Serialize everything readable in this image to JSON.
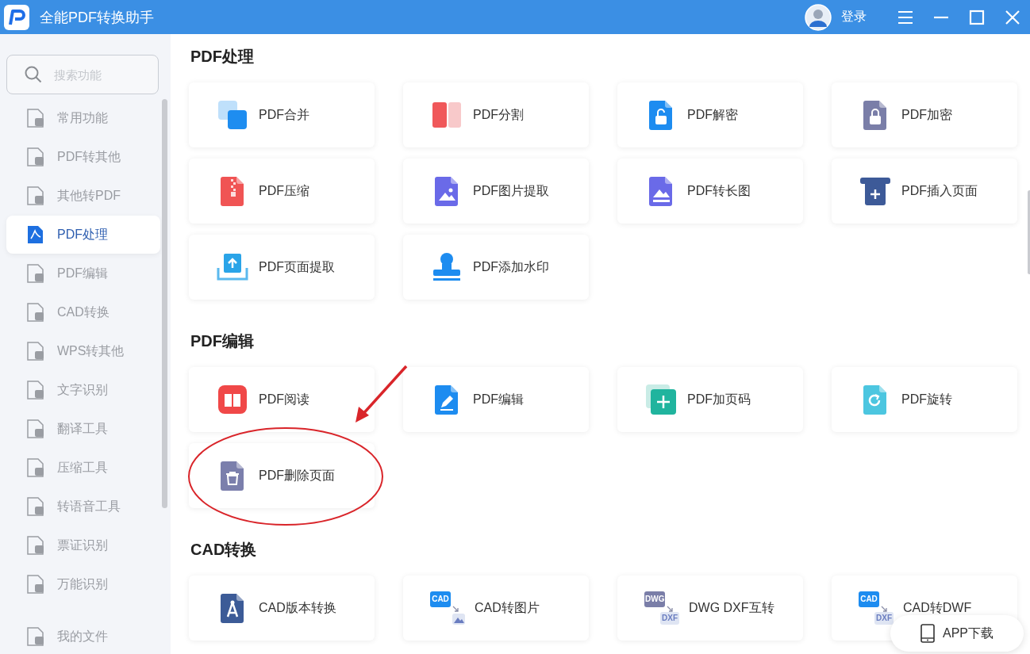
{
  "window": {
    "title": "全能PDF转换助手",
    "login": "登录"
  },
  "sidebar": {
    "search": {
      "placeholder": "搜索功能"
    },
    "items": [
      {
        "label": "常用功能",
        "selected": false
      },
      {
        "label": "PDF转其他",
        "selected": false
      },
      {
        "label": "其他转PDF",
        "selected": false
      },
      {
        "label": "PDF处理",
        "selected": true
      },
      {
        "label": "PDF编辑",
        "selected": false
      },
      {
        "label": "CAD转换",
        "selected": false
      },
      {
        "label": "WPS转其他",
        "selected": false
      },
      {
        "label": "文字识别",
        "selected": false
      },
      {
        "label": "翻译工具",
        "selected": false
      },
      {
        "label": "压缩工具",
        "selected": false
      },
      {
        "label": "转语音工具",
        "selected": false
      },
      {
        "label": "票证识别",
        "selected": false
      },
      {
        "label": "万能识别",
        "selected": false
      }
    ],
    "footer": {
      "label": "我的文件"
    }
  },
  "sections": [
    {
      "heading": "PDF处理",
      "cards": [
        {
          "label": "PDF合并",
          "kind": "merge"
        },
        {
          "label": "PDF分割",
          "kind": "split"
        },
        {
          "label": "PDF解密",
          "kind": "unlock"
        },
        {
          "label": "PDF加密",
          "kind": "lock"
        },
        {
          "label": "PDF压缩",
          "kind": "zip"
        },
        {
          "label": "PDF图片提取",
          "kind": "image"
        },
        {
          "label": "PDF转长图",
          "kind": "long-image"
        },
        {
          "label": "PDF插入页面",
          "kind": "insert"
        },
        {
          "label": "PDF页面提取",
          "kind": "extract"
        },
        {
          "label": "PDF添加水印",
          "kind": "watermark"
        }
      ]
    },
    {
      "heading": "PDF编辑",
      "cards": [
        {
          "label": "PDF阅读",
          "kind": "read"
        },
        {
          "label": "PDF编辑",
          "kind": "edit"
        },
        {
          "label": "PDF加页码",
          "kind": "page-number"
        },
        {
          "label": "PDF旋转",
          "kind": "rotate"
        },
        {
          "label": "PDF删除页面",
          "kind": "delete"
        }
      ]
    },
    {
      "heading": "CAD转换",
      "cards": [
        {
          "label": "CAD版本转换",
          "kind": "cad-version"
        },
        {
          "label": "CAD转图片",
          "kind": "format",
          "badges": [
            "CAD"
          ]
        },
        {
          "label": "DWG DXF互转",
          "kind": "format",
          "badges": [
            "DWG",
            "DXF"
          ]
        },
        {
          "label": "CAD转DWF",
          "kind": "format",
          "badges": [
            "CAD",
            "DXF"
          ]
        }
      ]
    }
  ],
  "app_download": {
    "label": "APP下载"
  }
}
